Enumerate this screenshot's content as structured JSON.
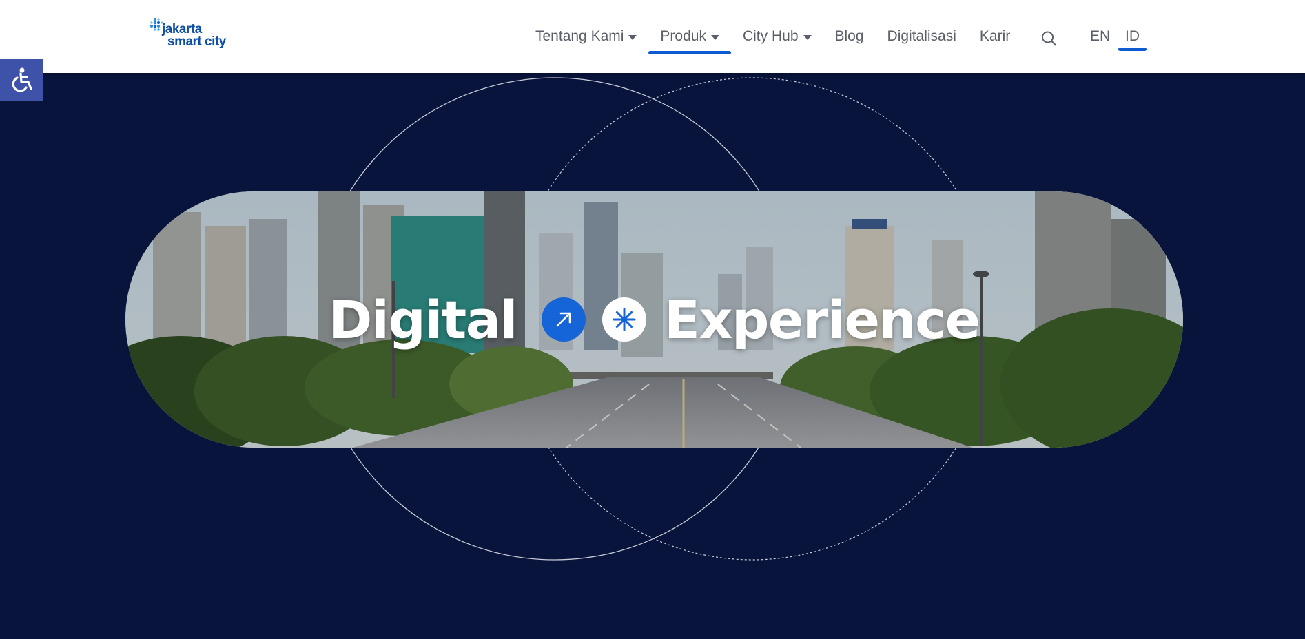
{
  "brand": {
    "logo_line1": "jakarta",
    "logo_line2": "smart city",
    "primary_color": "#0d5ad1",
    "hero_background": "#08143b",
    "accessibility_button_color": "#3d52a8"
  },
  "nav": {
    "items": [
      {
        "label": "Tentang Kami",
        "has_dropdown": true,
        "active": false
      },
      {
        "label": "Produk",
        "has_dropdown": true,
        "active": true
      },
      {
        "label": "City Hub",
        "has_dropdown": true,
        "active": false
      },
      {
        "label": "Blog",
        "has_dropdown": false,
        "active": false
      },
      {
        "label": "Digitalisasi",
        "has_dropdown": false,
        "active": false
      },
      {
        "label": "Karir",
        "has_dropdown": false,
        "active": false
      }
    ],
    "search_icon": "search-icon",
    "languages": {
      "en": "EN",
      "id": "ID",
      "selected": "ID"
    }
  },
  "accessibility": {
    "icon": "wheelchair-icon"
  },
  "hero": {
    "word1": "Digital",
    "word2": "Experience",
    "badge1_icon": "arrow-up-right-icon",
    "badge2_icon": "asterisk-icon"
  }
}
